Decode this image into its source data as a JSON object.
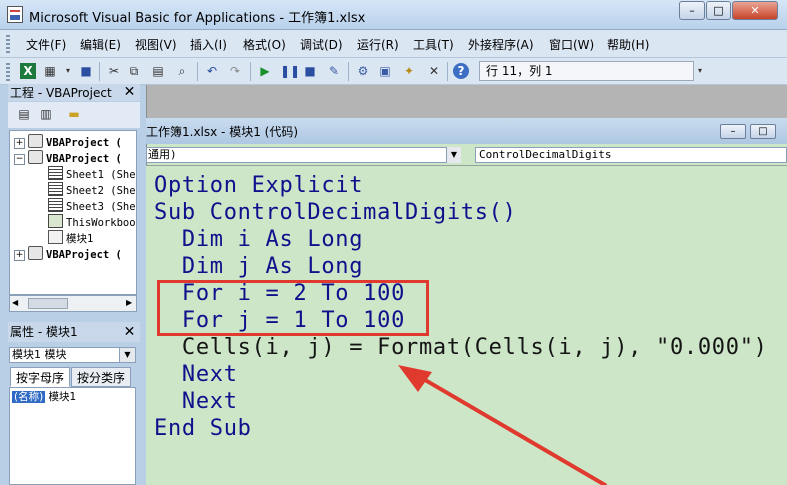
{
  "window": {
    "title": "Microsoft Visual Basic for Applications - 工作簿1.xlsx",
    "minimize": "–",
    "restore": "□",
    "close": "✕"
  },
  "menu": {
    "items": [
      "文件(F)",
      "编辑(E)",
      "视图(V)",
      "插入(I)",
      "格式(O)",
      "调试(D)",
      "运行(R)",
      "工具(T)",
      "外接程序(A)",
      "窗口(W)",
      "帮助(H)"
    ]
  },
  "toolbar": {
    "position_status": "行 11，列 1",
    "icons": [
      "excel-icon",
      "insert-module-icon",
      "save-icon",
      "cut-icon",
      "copy-icon",
      "paste-icon",
      "find-icon",
      "undo-icon",
      "redo-icon",
      "run-icon",
      "break-icon",
      "reset-icon",
      "design-mode-icon",
      "project-explorer-icon",
      "properties-icon",
      "object-browser-icon",
      "toolbox-icon",
      "help-icon"
    ]
  },
  "project_explorer": {
    "title": "工程 - VBAProject",
    "tree": [
      {
        "label": "VBAProject (",
        "expander": "+"
      },
      {
        "label": "VBAProject (",
        "expander": "−"
      },
      {
        "label": "Sheet1 (She",
        "expander": ""
      },
      {
        "label": "Sheet2 (She",
        "expander": ""
      },
      {
        "label": "Sheet3 (She",
        "expander": ""
      },
      {
        "label": "ThisWorkbool",
        "expander": ""
      },
      {
        "label": "模块1",
        "expander": ""
      },
      {
        "label": "VBAProject (",
        "expander": "+"
      }
    ]
  },
  "properties": {
    "title": "属性 - 模块1",
    "object_select": "模块1 模块",
    "tabs": [
      "按字母序",
      "按分类序"
    ],
    "row_name_key": "(名称)",
    "row_name_value": "模块1"
  },
  "code_window": {
    "title": "工作簿1.xlsx - 模块1 (代码)",
    "object_combo": "通用)",
    "procedure_combo": "ControlDecimalDigits",
    "lines": [
      "Option Explicit",
      "Sub ControlDecimalDigits()",
      "  Dim i As Long",
      "  Dim j As Long",
      "  For i = 2 To 100",
      "  For j = 1 To 100",
      "  Cells(i, j) = Format(Cells(i, j), \"0.000\")",
      "  Next",
      "  Next",
      "End Sub"
    ]
  },
  "annotation": {
    "color": "#e03a2e"
  }
}
